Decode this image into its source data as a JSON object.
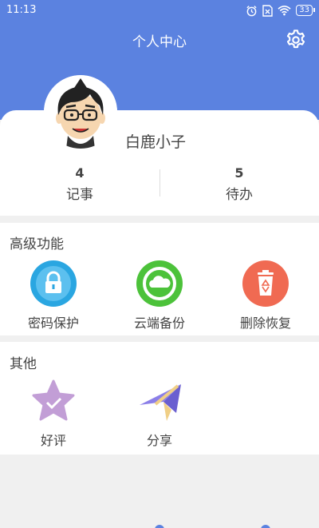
{
  "status_bar": {
    "time": "11:13",
    "battery": "33",
    "icons": [
      "alarm-icon",
      "sim-off-icon",
      "wifi-icon",
      "battery-icon"
    ]
  },
  "header": {
    "title": "个人中心",
    "settings_icon": "gear-icon",
    "background_color": "#5b82e0"
  },
  "profile": {
    "username": "白鹿小子",
    "stats": [
      {
        "count": "4",
        "label": "记事"
      },
      {
        "count": "5",
        "label": "待办"
      }
    ]
  },
  "advanced": {
    "title": "高级功能",
    "items": [
      {
        "label": "密码保护",
        "icon": "lock-icon",
        "color": "#2aa6e1"
      },
      {
        "label": "云端备份",
        "icon": "cloud-icon",
        "color": "#4cc23a"
      },
      {
        "label": "删除恢复",
        "icon": "recycle-bin-icon",
        "color": "#f06a52"
      }
    ]
  },
  "others": {
    "title": "其他",
    "items": [
      {
        "label": "好评",
        "icon": "star-check-icon",
        "color": "#c29ed6"
      },
      {
        "label": "分享",
        "icon": "paper-plane-icon",
        "color": "#8b7fe8"
      }
    ]
  }
}
